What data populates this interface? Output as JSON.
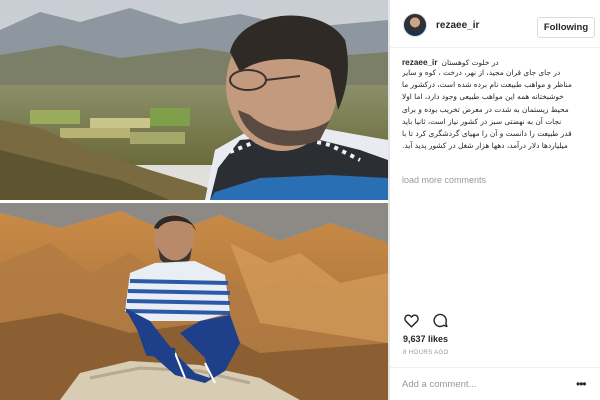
{
  "post": {
    "username": "rezaee_ir",
    "follow_label": "Following",
    "caption": {
      "username": "rezaee_ir",
      "title": "در خلوت کوهستان",
      "lines": [
        "در جای جای قران مجید، از نهر، درخت ، کوه و سایر",
        "مناظر و مواهب طبیعت نام برده شده است، درکشور ما",
        "خوشبختانه همه این مواهب طبیعی وجود دارد، اما اولا",
        "محیط زیستمان به شدت در معرض تخریب بوده و برای",
        "نجات آن به نهضتی سبز در کشور نیاز است، ثانیا باید",
        "قدر طبیعت را دانست و آن را مهیای گردشگری کرد تا با",
        "میلیاردها دلار درآمد، دهها هزار شغل در کشور پدید آید."
      ]
    },
    "load_more_label": "load more comments",
    "likes": "9,637 likes",
    "timestamp": "8 HOURS AGO",
    "comment_placeholder": "Add a comment...",
    "more_label": "•••",
    "icons": {
      "like": "heart-icon",
      "comment": "comment-icon",
      "more": "more-options-icon"
    }
  },
  "photos": [
    {
      "name": "photo-mountain-valley",
      "description_visible": false
    },
    {
      "name": "photo-rocky-hill",
      "description_visible": false
    }
  ],
  "colors": {
    "text": "#262626",
    "secondary": "#999999",
    "border": "#dbdbdb"
  }
}
